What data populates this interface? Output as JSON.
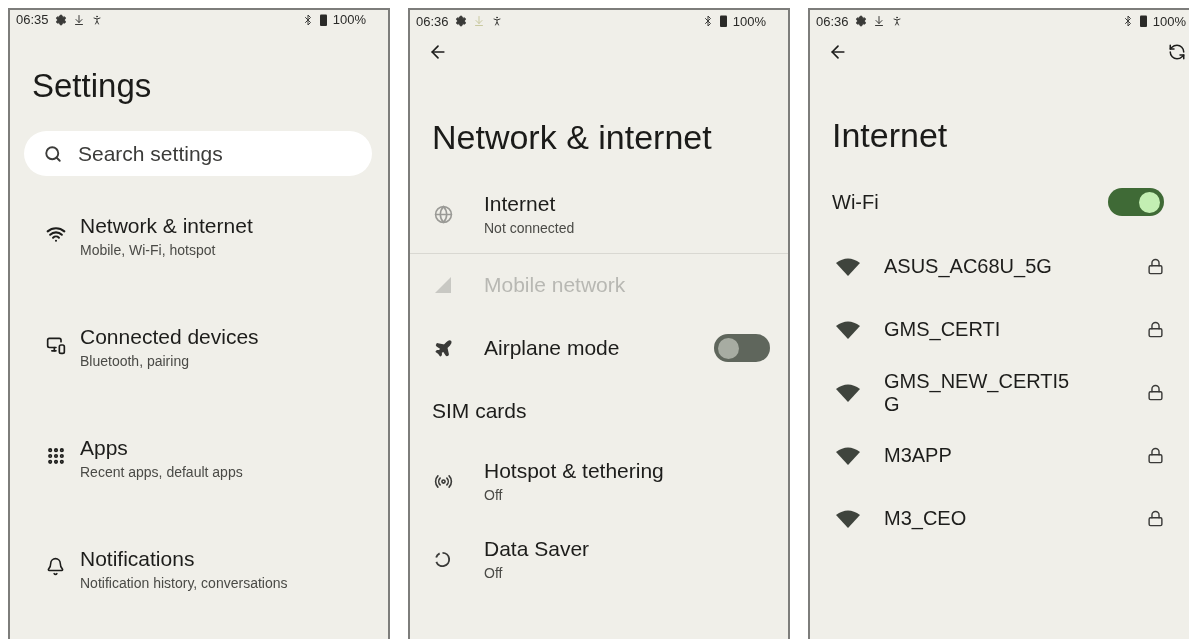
{
  "settings_screen": {
    "status_bar": {
      "time": "06:35",
      "battery": "100%"
    },
    "title": "Settings",
    "search": {
      "placeholder": "Search settings"
    },
    "items": [
      {
        "title": "Network & internet",
        "subtitle": "Mobile, Wi-Fi, hotspot"
      },
      {
        "title": "Connected devices",
        "subtitle": "Bluetooth, pairing"
      },
      {
        "title": "Apps",
        "subtitle": "Recent apps, default apps"
      },
      {
        "title": "Notifications",
        "subtitle": "Notification history, conversations"
      }
    ]
  },
  "network_screen": {
    "status_bar": {
      "time": "06:36",
      "battery": "100%"
    },
    "title": "Network & internet",
    "items": [
      {
        "kind": "entry",
        "title": "Internet",
        "subtitle": "Not connected",
        "disabled": false
      },
      {
        "kind": "entry",
        "title": "Mobile network",
        "disabled": true
      },
      {
        "kind": "toggle",
        "title": "Airplane mode",
        "on": false
      },
      {
        "kind": "header",
        "title": "SIM cards"
      },
      {
        "kind": "entry",
        "title": "Hotspot & tethering",
        "subtitle": "Off",
        "disabled": false
      },
      {
        "kind": "entry",
        "title": "Data Saver",
        "subtitle": "Off",
        "disabled": false
      }
    ]
  },
  "internet_screen": {
    "status_bar": {
      "time": "06:36",
      "battery": "100%"
    },
    "title": "Internet",
    "wifi": {
      "label": "Wi-Fi",
      "on": true
    },
    "networks": [
      {
        "name": "ASUS_AC68U_5G",
        "locked": true
      },
      {
        "name": "GMS_CERTI",
        "locked": true
      },
      {
        "name": "GMS_NEW_CERTI5G",
        "locked": true
      },
      {
        "name": "M3APP",
        "locked": true
      },
      {
        "name": "M3_CEO",
        "locked": true
      }
    ]
  }
}
